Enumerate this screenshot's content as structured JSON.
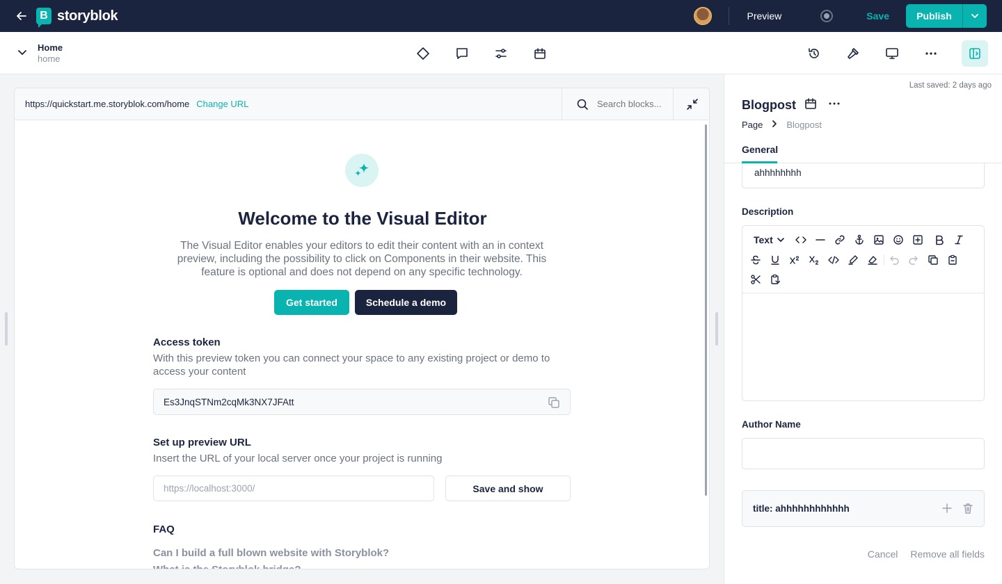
{
  "app": {
    "logo_text": "storyblok",
    "logo_letter": "B"
  },
  "topbar": {
    "preview_label": "Preview",
    "save_label": "Save",
    "publish_label": "Publish"
  },
  "story": {
    "name": "Home",
    "slug": "home"
  },
  "preview": {
    "url": "https://quickstart.me.storyblok.com/home",
    "change_url_label": "Change URL",
    "search_placeholder": "Search blocks...",
    "welcome_title": "Welcome to the Visual Editor",
    "welcome_desc": "The Visual Editor enables your editors to edit their content with an in context preview, including the possibility to click on Components in their website. This feature is optional and does not depend on any specific technology.",
    "get_started_label": "Get started",
    "schedule_demo_label": "Schedule a demo",
    "access_token_title": "Access token",
    "access_token_desc": "With this preview token you can connect your space to any existing project or demo to access your content",
    "access_token_value": "Es3JnqSTNm2cqMk3NX7JFAtt",
    "preview_url_title": "Set up preview URL",
    "preview_url_desc": "Insert the URL of your local server once your project is running",
    "preview_url_placeholder": "https://localhost:3000/",
    "save_and_show_label": "Save and show",
    "faq_title": "FAQ",
    "faq_items": [
      "Can I build a full blown website with Storyblok?",
      "What is the Storyblok bridge?"
    ]
  },
  "sidebar": {
    "last_saved": "Last saved: 2 days ago",
    "block_title": "Blogpost",
    "breadcrumb_page": "Page",
    "breadcrumb_current": "Blogpost",
    "tab_general": "General",
    "title_value": "ahhhhhhhh",
    "description_label": "Description",
    "text_style_label": "Text",
    "author_label": "Author Name",
    "nested_block_title": "title: ahhhhhhhhhhhh",
    "cancel_label": "Cancel",
    "remove_all_label": "Remove all fields"
  },
  "colors": {
    "brand": "#09b3af",
    "navbar": "#1b243f",
    "accent_light": "#d9f4f3"
  }
}
